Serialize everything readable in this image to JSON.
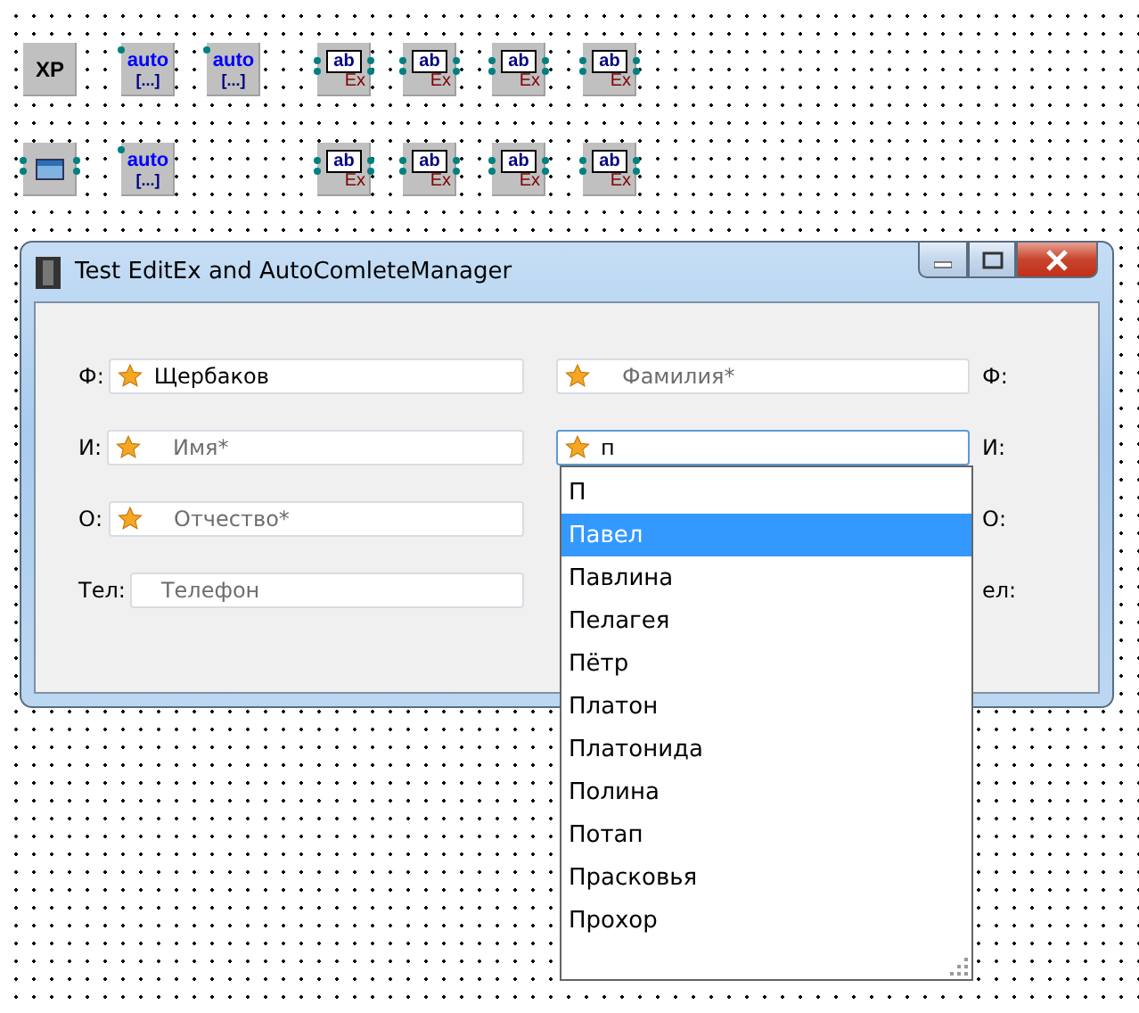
{
  "palette": [
    {
      "kind": "xp",
      "label": "XP"
    },
    {
      "kind": "auto",
      "label": "auto",
      "sublabel": "[...]"
    },
    {
      "kind": "auto",
      "label": "auto",
      "sublabel": "[...]"
    },
    {
      "kind": "editex",
      "label": "ab",
      "sublabel": "Ex"
    },
    {
      "kind": "editex",
      "label": "ab",
      "sublabel": "Ex"
    },
    {
      "kind": "editex",
      "label": "ab",
      "sublabel": "Ex"
    },
    {
      "kind": "editex",
      "label": "ab",
      "sublabel": "Ex"
    },
    {
      "kind": "form"
    },
    {
      "kind": "auto",
      "label": "auto",
      "sublabel": "[...]"
    },
    {
      "kind": "editex",
      "label": "ab",
      "sublabel": "Ex"
    },
    {
      "kind": "editex",
      "label": "ab",
      "sublabel": "Ex"
    },
    {
      "kind": "editex",
      "label": "ab",
      "sublabel": "Ex"
    },
    {
      "kind": "editex",
      "label": "ab",
      "sublabel": "Ex"
    }
  ],
  "window": {
    "title": "Test EditEx and AutoComleteManager",
    "left_fields": [
      {
        "label": "Ф:",
        "value": "Щербаков",
        "star": true
      },
      {
        "label": "И:",
        "placeholder": "Имя*",
        "star": true
      },
      {
        "label": "О:",
        "placeholder": "Отчество*",
        "star": true
      },
      {
        "label": "Тел:",
        "placeholder": "Телефон",
        "star": false
      }
    ],
    "right_fields": [
      {
        "label": "Ф:",
        "placeholder": "Фамилия*",
        "star": true,
        "focused": false
      },
      {
        "label": "И:",
        "value": "п",
        "star": true,
        "focused": true
      },
      {
        "label": "О:"
      },
      {
        "label": "ел:"
      }
    ]
  },
  "suggestions": [
    {
      "text": "П",
      "selected": false
    },
    {
      "text": "Павел",
      "selected": true
    },
    {
      "text": "Павлина",
      "selected": false
    },
    {
      "text": "Пелагея",
      "selected": false
    },
    {
      "text": "Пётр",
      "selected": false
    },
    {
      "text": "Платон",
      "selected": false
    },
    {
      "text": "Платонида",
      "selected": false
    },
    {
      "text": "Полина",
      "selected": false
    },
    {
      "text": "Потап",
      "selected": false
    },
    {
      "text": "Прасковья",
      "selected": false
    },
    {
      "text": "Прохор",
      "selected": false
    }
  ]
}
